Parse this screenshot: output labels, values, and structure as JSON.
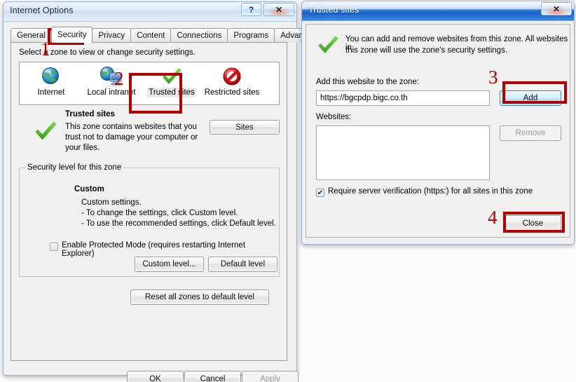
{
  "internet_options": {
    "title": "Internet Options",
    "help_button": "?",
    "close_button": "✕",
    "tabs": [
      {
        "label": "General",
        "selected": false
      },
      {
        "label": "Security",
        "selected": true
      },
      {
        "label": "Privacy",
        "selected": false
      },
      {
        "label": "Content",
        "selected": false
      },
      {
        "label": "Connections",
        "selected": false
      },
      {
        "label": "Programs",
        "selected": false
      },
      {
        "label": "Advanced",
        "selected": false
      }
    ],
    "zone_prompt": "Select a zone to view or change security settings.",
    "zones": [
      {
        "label": "Internet",
        "icon": "globe-icon",
        "selected": false
      },
      {
        "label": "Local intranet",
        "icon": "globe-computer-icon",
        "selected": false
      },
      {
        "label": "Trusted sites",
        "icon": "green-check-icon",
        "selected": true
      },
      {
        "label": "Restricted sites",
        "icon": "red-prohibition-icon",
        "selected": false
      }
    ],
    "zone_detail": {
      "name": "Trusted sites",
      "description_line1": "This zone contains websites that you",
      "description_line2": "trust not to damage your computer or",
      "description_line3": "your files.",
      "sites_button": "Sites"
    },
    "security_level": {
      "legend": "Security level for this zone",
      "level_name": "Custom",
      "line1": "Custom settings.",
      "line2": "- To change the settings, click Custom level.",
      "line3": "- To use the recommended settings, click Default level.",
      "protected_mode_label": "Enable Protected Mode (requires restarting Internet Explorer)",
      "protected_mode_checked": false,
      "custom_level_button": "Custom level...",
      "default_level_button": "Default level"
    },
    "reset_button": "Reset all zones to default level",
    "footer": {
      "ok": "OK",
      "cancel": "Cancel",
      "apply": "Apply",
      "apply_disabled": true
    }
  },
  "trusted_sites": {
    "title": "Trusted sites",
    "close_button": "✕",
    "info_line1": "You can add and remove websites from this zone. All websites in",
    "info_line2": "this zone will use the zone's security settings.",
    "add_label": "Add this website to the zone:",
    "url_value": "https://bgcpdp.bigc.co.th",
    "add_button": "Add",
    "websites_label": "Websites:",
    "websites_items": [],
    "remove_button": "Remove",
    "remove_disabled": true,
    "require_verification_label": "Require server verification (https:) for all sites in this zone",
    "require_verification_checked": true,
    "close_label": "Close"
  },
  "annotations": {
    "markers": [
      {
        "number": "1",
        "target": "security-tab"
      },
      {
        "number": "2",
        "target": "trusted-sites-zone"
      },
      {
        "number": "3",
        "target": "add-button"
      },
      {
        "number": "4",
        "target": "close-button"
      }
    ],
    "color": "#b50000"
  }
}
